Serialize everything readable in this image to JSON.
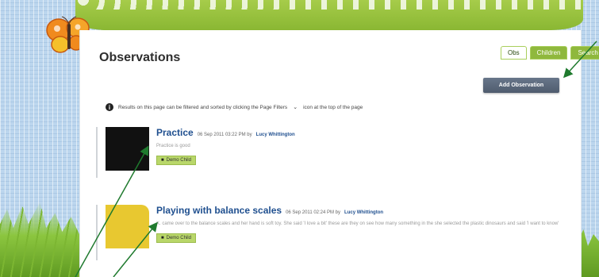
{
  "nav": {
    "tabs": [
      {
        "label": "Obs",
        "active": true
      },
      {
        "label": "Children",
        "active": false
      },
      {
        "label": "Search",
        "active": false,
        "dropdown": true
      }
    ]
  },
  "page": {
    "title": "Observations",
    "add_button": "Add Observation",
    "info_text_before": "Results on this page can be filtered and sorted by clicking the Page Filters",
    "info_text_after": "icon at the top of the page"
  },
  "observations": [
    {
      "title": "Practice",
      "date": "06 Sep 2011 03:22 PM by",
      "author": "Lucy Whittington",
      "description": "Practice is good",
      "child": "Demo Child",
      "thumb_color": "#111111"
    },
    {
      "title": "Playing with balance scales",
      "date": "06 Sep 2011 02:24 PM by",
      "author": "Lucy Whittington",
      "description": "X. came over to the balance scales and her hand is soft toy. She said 'I love a bit' these are they on see how many something in the she selected the plastic dinosaurs and said 'I want to know'",
      "child": "Demo Child",
      "thumb_color": "#e8c830"
    }
  ],
  "colors": {
    "accent_green": "#8fb83d",
    "link_blue": "#1f4f8f",
    "button_slate": "#5a6779",
    "annotation_arrow": "#1f7a2e"
  },
  "icons": [
    "butterfly-icon",
    "info-icon",
    "chevron-down-icon",
    "tag-icon"
  ]
}
